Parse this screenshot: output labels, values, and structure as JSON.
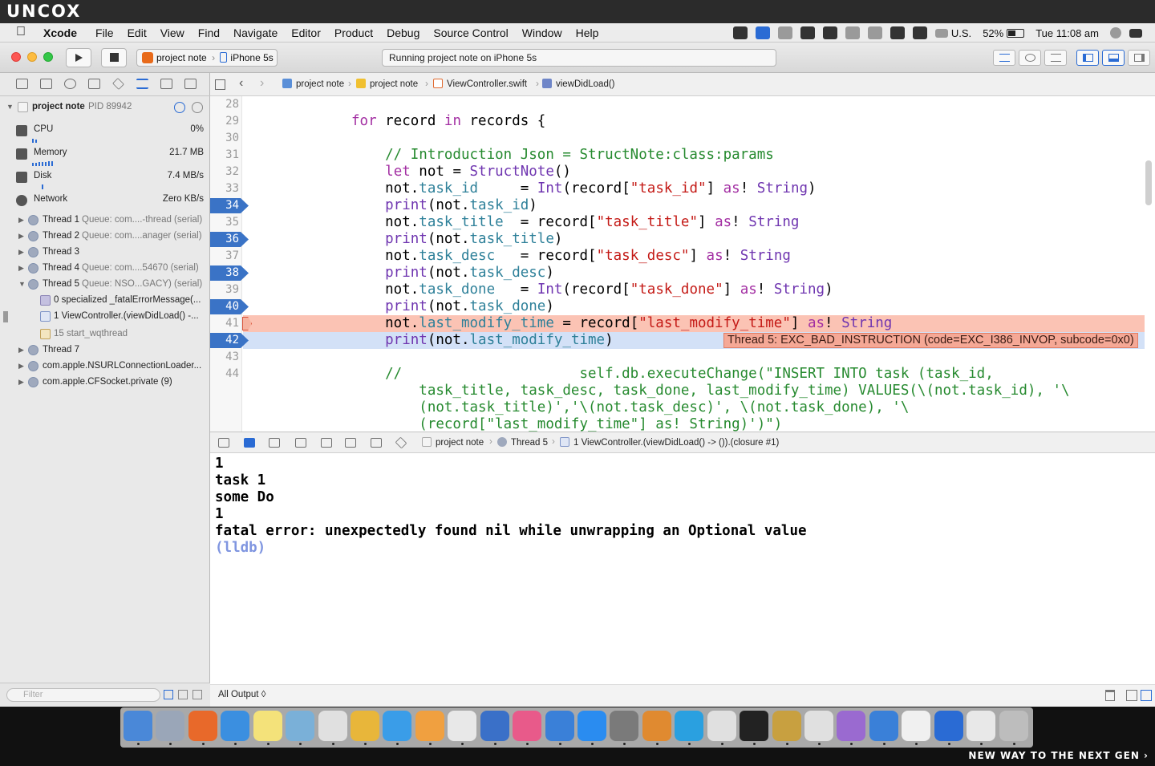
{
  "branding": {
    "logo": "UNCOX",
    "tagline": "NEW WAY TO THE NEXT GEN ›"
  },
  "menubar": {
    "app_name": "Xcode",
    "menus": [
      "File",
      "Edit",
      "View",
      "Find",
      "Navigate",
      "Editor",
      "Product",
      "Debug",
      "Source Control",
      "Window",
      "Help"
    ],
    "input_source": "U.S.",
    "battery": "52%",
    "battery_level": 0.52,
    "clock": "Tue 11:08 am"
  },
  "toolbar": {
    "scheme": "project note",
    "device": "iPhone 5s",
    "activity": "Running project note on iPhone 5s"
  },
  "navigator": {
    "process": {
      "name": "project note",
      "pid": "PID 89942"
    },
    "gauges": [
      {
        "label": "CPU",
        "value": "0%"
      },
      {
        "label": "Memory",
        "value": "21.7 MB"
      },
      {
        "label": "Disk",
        "value": "7.4 MB/s"
      },
      {
        "label": "Network",
        "value": "Zero KB/s"
      }
    ],
    "threads": [
      {
        "name": "Thread 1",
        "queue": "Queue: com....-thread (serial)"
      },
      {
        "name": "Thread 2",
        "queue": "Queue: com....anager (serial)"
      },
      {
        "name": "Thread 3",
        "queue": ""
      },
      {
        "name": "Thread 4",
        "queue": "Queue: com....54670 (serial)"
      },
      {
        "name": "Thread 5",
        "queue": "Queue: NSO...GACY) (serial)"
      }
    ],
    "frames": [
      "0 specialized _fatalErrorMessage(...",
      "1 ViewController.(viewDidLoad() -...",
      "15 start_wqthread"
    ],
    "threads_after": [
      "Thread 7",
      "com.apple.NSURLConnectionLoader...",
      "com.apple.CFSocket.private (9)"
    ],
    "filter_placeholder": "Filter"
  },
  "jumpbar": [
    "project note",
    "project note",
    "ViewController.swift",
    "viewDidLoad()"
  ],
  "editor": {
    "line_numbers": [
      "28",
      "29",
      "30",
      "31",
      "32",
      "33",
      "34",
      "35",
      "36",
      "37",
      "38",
      "39",
      "40",
      "41",
      "42",
      "43",
      "44"
    ],
    "breakpoint_lines": [
      "34",
      "36",
      "38",
      "40",
      "42"
    ],
    "error_message": "Thread 5: EXC_BAD_INSTRUCTION (code=EXC_I386_INVOP, subcode=0x0)",
    "lines": {
      "l29": {
        "indent": "                ",
        "kw": "for",
        "var": " record ",
        "kw2": "in",
        "rest": " records {"
      },
      "l31": "    // Introduction Json = StructNote:class:params",
      "l32": {
        "indent": "    ",
        "kw": "let",
        "mid": " not = ",
        "tp": "StructNote",
        "end": "()"
      },
      "l33": {
        "obj": "    not.",
        "prop": "task_id",
        "pad": "     = ",
        "fn": "Int",
        "a": "(record[",
        "key": "\"task_id\"",
        "b": "] ",
        "as": "as",
        "c": "! ",
        "tp": "String",
        "d": ")"
      },
      "l34": {
        "fn": "    print",
        "a": "(not.",
        "prop": "task_id",
        "b": ")"
      },
      "l35": {
        "obj": "    not.",
        "prop": "task_title",
        "pad": "  = record[",
        "key": "\"task_title\"",
        "b": "] ",
        "as": "as",
        "c": "! ",
        "tp": "String"
      },
      "l36": {
        "fn": "    print",
        "a": "(not.",
        "prop": "task_title",
        "b": ")"
      },
      "l37": {
        "obj": "    not.",
        "prop": "task_desc",
        "pad": "   = record[",
        "key": "\"task_desc\"",
        "b": "] ",
        "as": "as",
        "c": "! ",
        "tp": "String"
      },
      "l38": {
        "fn": "    print",
        "a": "(not.",
        "prop": "task_desc",
        "b": ")"
      },
      "l39": {
        "obj": "    not.",
        "prop": "task_done",
        "pad": "   = ",
        "fn": "Int",
        "a": "(record[",
        "key": "\"task_done\"",
        "b": "] ",
        "as": "as",
        "c": "! ",
        "tp": "String",
        "d": ")"
      },
      "l40": {
        "fn": "    print",
        "a": "(not.",
        "prop": "task_done",
        "b": ")"
      },
      "l41": {
        "obj": "    not.",
        "prop": "last_modify_time",
        "pad": " = record[",
        "key": "\"last_modify_time\"",
        "b": "] ",
        "as": "as",
        "c": "! ",
        "tp": "String"
      },
      "l42": {
        "fn": "    print",
        "a": "(not.",
        "prop": "last_modify_time",
        "b": ")"
      },
      "l44a": "    //                     self.db.executeChange(\"INSERT INTO task (task_id,",
      "l44b": "        task_title, task_desc, task_done, last_modify_time) VALUES(\\(not.task_id), '\\",
      "l44c": "        (not.task_title)','\\(not.task_desc)', \\(not.task_done), '\\",
      "l44d": "        (record[\"last_modify_time\"] as! String)')\")"
    }
  },
  "debugbar": {
    "crumbs": [
      "project note",
      "Thread 5",
      "1 ViewController.(viewDidLoad() -> ()).(closure #1)"
    ]
  },
  "console": {
    "lines": [
      "1",
      "task 1",
      "some Do",
      "1",
      "fatal error: unexpectedly found nil while unwrapping an Optional value"
    ],
    "prompt": "(lldb)",
    "output_selector": "All Output ◊"
  },
  "dock": {
    "apps": [
      "finder-icon",
      "launchpad-icon",
      "firefox-icon",
      "safari-icon",
      "notes-icon",
      "preview-icon",
      "java-icon",
      "chrome-icon",
      "messages-icon",
      "photos-icon",
      "textedit-icon",
      "keynote-icon",
      "itunes-icon",
      "xcode-icon",
      "appstore-icon",
      "system-preferences-icon",
      "sublime-icon",
      "telegram-icon",
      "sequel-pro-icon",
      "terminal-icon",
      "archive-icon",
      "java-tool-icon",
      "network-icon",
      "simulator-icon",
      "vlc-document-icon",
      "downloads-icon",
      "screenshots-icon",
      "trash-icon"
    ],
    "colors": [
      "#4a88d8",
      "#9aa6b8",
      "#e8692a",
      "#3b8fe0",
      "#f4e27a",
      "#7ab0d8",
      "#e0e0e0",
      "#e8b63a",
      "#3a9de8",
      "#f0a040",
      "#e8e8e8",
      "#3a70c8",
      "#e85a8a",
      "#3a80d8",
      "#2a8cf0",
      "#7a7a7a",
      "#e08a30",
      "#2aa0e0",
      "#e0e0e0",
      "#222222",
      "#c8a040",
      "#e0e0e0",
      "#9a6ad0",
      "#3a80d8",
      "#f0f0f0",
      "#2a6bd4",
      "#e8e8e8",
      "#bdbdbd"
    ]
  }
}
